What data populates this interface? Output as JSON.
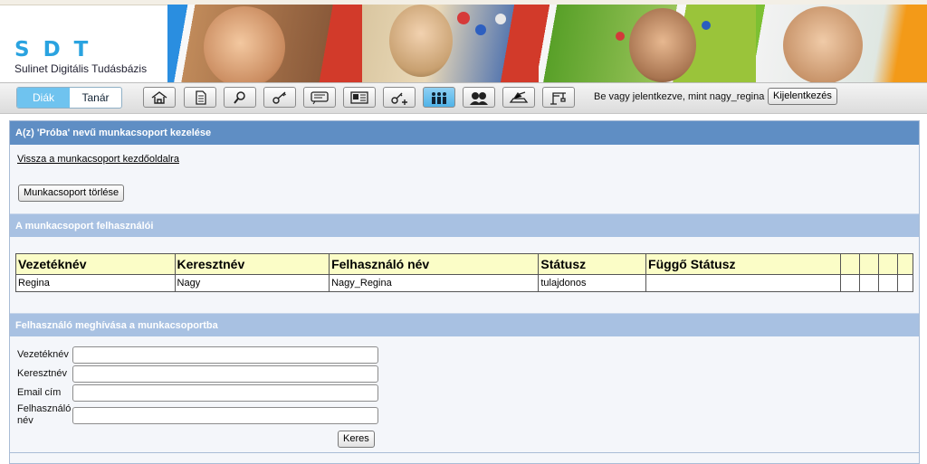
{
  "header": {
    "logo_letters": "SDT",
    "logo_subtitle": "Sulinet Digitális Tudásbázis"
  },
  "toolbar": {
    "role_student": "Diák",
    "role_teacher": "Tanár",
    "icons": [
      "home-icon",
      "document-icon",
      "search-icon",
      "key-icon",
      "message-icon",
      "card-icon",
      "key-plus-icon",
      "group-icon",
      "users-icon",
      "tools-icon",
      "crane-icon"
    ],
    "logged_in_text": "Be vagy jelentkezve, mint nagy_regina",
    "logout_label": "Kijelentkezés"
  },
  "main": {
    "section_title": "A(z) 'Próba' nevű munkacsoport kezelése",
    "back_link": "Vissza a munkacsoport kezdőoldalra",
    "delete_button": "Munkacsoport törlése",
    "users_title": "A munkacsoport felhasználói",
    "table": {
      "headers": [
        "Vezetéknév",
        "Keresztnév",
        "Felhasználó név",
        "Státusz",
        "Függő Státusz"
      ],
      "rows": [
        {
          "lastname": "Regina",
          "firstname": "Nagy",
          "username": "Nagy_Regina",
          "status": "tulajdonos",
          "pending": ""
        }
      ]
    },
    "invite_title": "Felhasználó meghívása a munkacsoportba",
    "form": {
      "lastname_label": "Vezetéknév",
      "firstname_label": "Keresztnév",
      "email_label": "Email cím",
      "username_label": "Felhasználó név",
      "search_button": "Keres"
    }
  },
  "colors": {
    "section_dark": "#5f8ec4",
    "section_light": "#a8c1e2",
    "table_header": "#fbfdc7",
    "accent": "#6fc3ef"
  }
}
